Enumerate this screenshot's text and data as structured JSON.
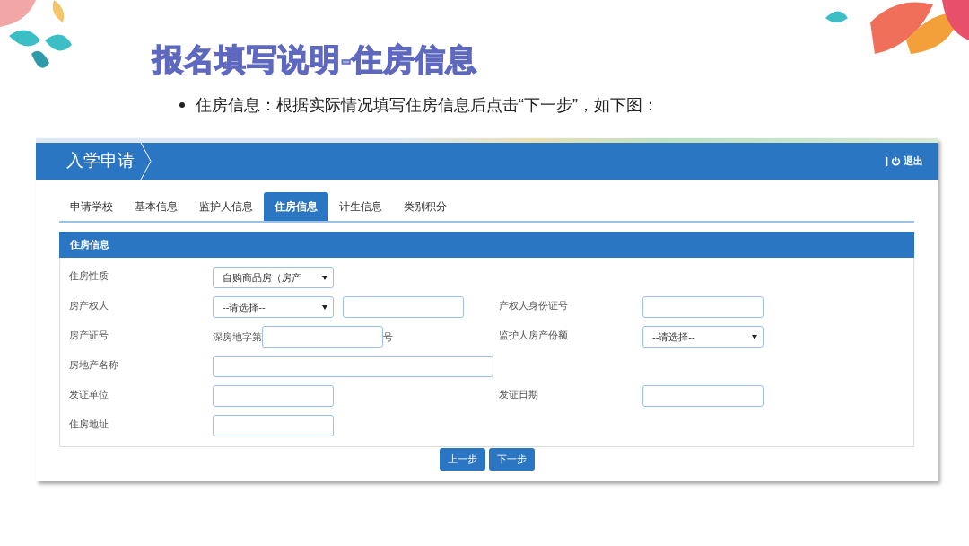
{
  "slide": {
    "title": "报名填写说明-住房信息",
    "bullet": "住房信息：根据实际情况填写住房信息后点击“下一步”，如下图："
  },
  "app": {
    "header": {
      "title": "入学申请",
      "separator": "|",
      "logout": "退出"
    },
    "tabs": [
      {
        "label": "申请学校",
        "selected": false
      },
      {
        "label": "基本信息",
        "selected": false
      },
      {
        "label": "监护人信息",
        "selected": false
      },
      {
        "label": "住房信息",
        "selected": true
      },
      {
        "label": "计生信息",
        "selected": false
      },
      {
        "label": "类别积分",
        "selected": false
      }
    ],
    "section_title": "住房信息",
    "rows": [
      {
        "label": "住房性质",
        "controls": [
          {
            "kind": "select",
            "value": "自购商品房（房产"
          }
        ]
      },
      {
        "label": "房产权人",
        "controls": [
          {
            "kind": "select",
            "value": "--请选择--"
          },
          {
            "kind": "input"
          }
        ],
        "right": {
          "label": "产权人身份证号",
          "controls": [
            {
              "kind": "input"
            }
          ]
        }
      },
      {
        "label": "房产证号",
        "controls": [
          {
            "kind": "text",
            "value": "深房地字第"
          },
          {
            "kind": "input"
          },
          {
            "kind": "text",
            "value": "号"
          }
        ],
        "right": {
          "label": "监护人房产份额",
          "controls": [
            {
              "kind": "select",
              "value": "--请选择--"
            }
          ]
        }
      },
      {
        "label": "房地产名称",
        "controls": [
          {
            "kind": "wide-input"
          }
        ]
      },
      {
        "label": "发证单位",
        "controls": [
          {
            "kind": "input"
          }
        ],
        "right": {
          "label": "发证日期",
          "controls": [
            {
              "kind": "input"
            }
          ]
        }
      },
      {
        "label": "住房地址",
        "controls": [
          {
            "kind": "input"
          }
        ]
      }
    ],
    "buttons": [
      "上一步",
      "下一步"
    ]
  }
}
